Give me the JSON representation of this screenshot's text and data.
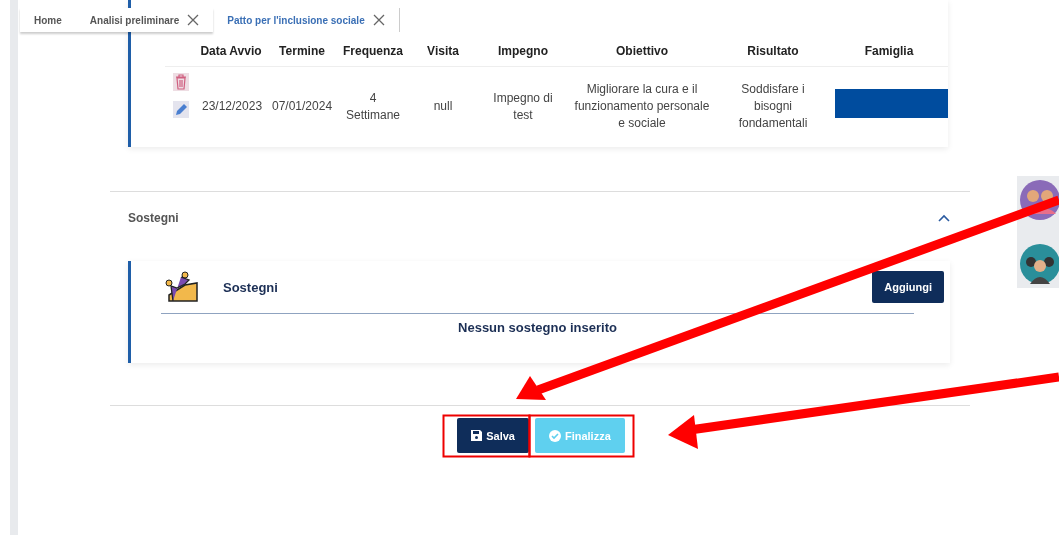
{
  "tabs": [
    {
      "label": "Home",
      "selected": false,
      "closable": false
    },
    {
      "label": "Analisi preliminare",
      "selected": false,
      "closable": true
    },
    {
      "label": "Patto per l'inclusione sociale",
      "selected": true,
      "closable": true
    }
  ],
  "impegni_table": {
    "columns": [
      "Data Avvio",
      "Termine",
      "Frequenza",
      "Visita",
      "Impegno",
      "Obiettivo",
      "Risultato",
      "Famiglia"
    ],
    "rows": [
      {
        "cells": [
          "23/12/2023",
          "07/01/2024",
          "4 Settimane",
          "null",
          "Impegno di test",
          "Migliorare la cura e il funzionamento personale e sociale",
          "Soddisfare i bisogni fondamentali"
        ],
        "redacted_family": true
      }
    ]
  },
  "sostegni_section": {
    "title": "Sostegni",
    "expanded": true,
    "card": {
      "title": "Sostegni",
      "add_button": "Aggiungi",
      "empty_message": "Nessun sostegno inserito"
    }
  },
  "actions": [
    {
      "label": "Salva",
      "kind": "save",
      "disabled": false
    },
    {
      "label": "Finalizza",
      "kind": "finalize",
      "disabled": true
    }
  ]
}
